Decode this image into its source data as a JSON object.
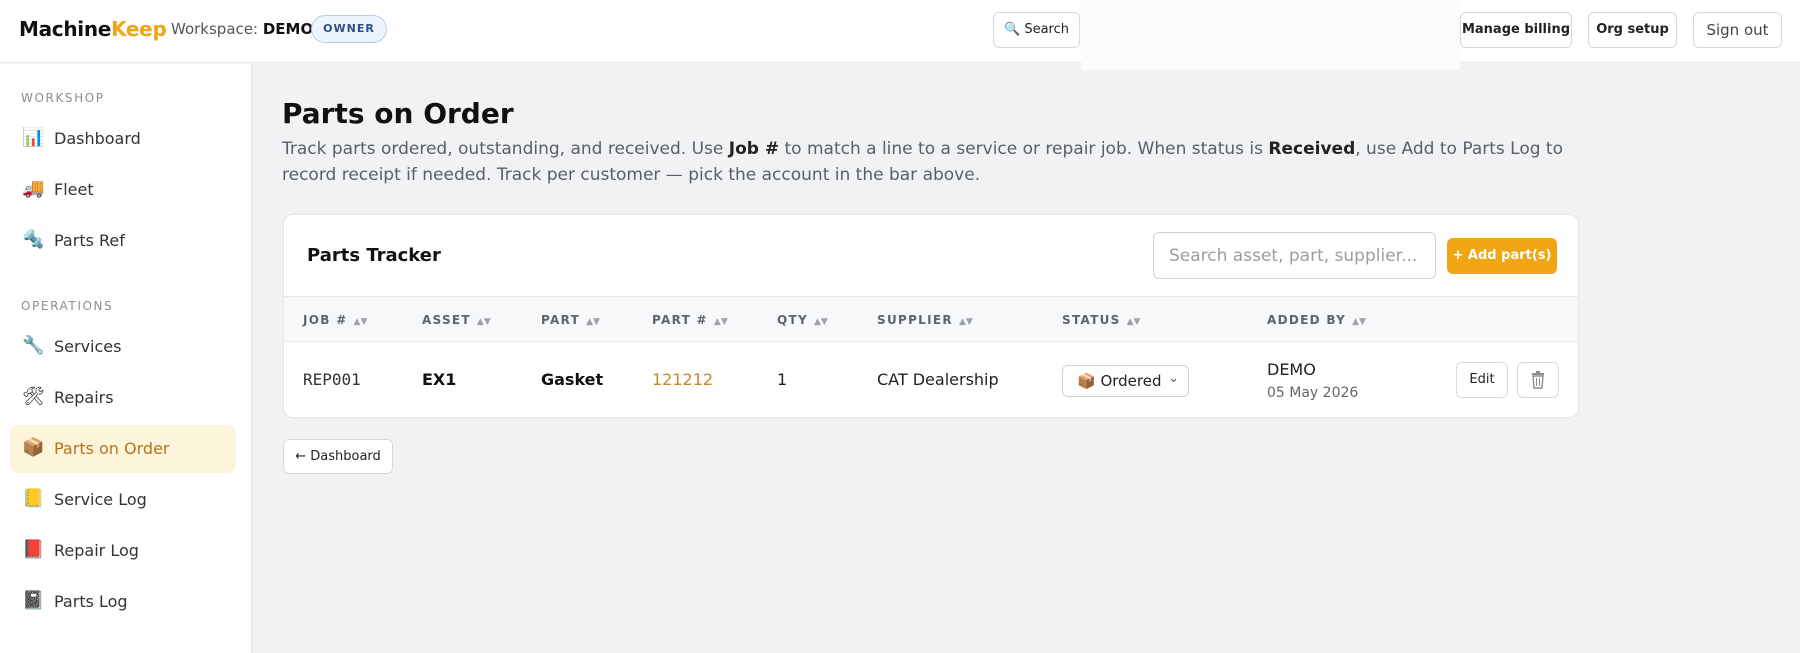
{
  "topbar": {
    "logo_main": "Machine",
    "logo_accent": "Keep",
    "workspace_label": "Workspace:",
    "workspace_name": "DEMO",
    "role_badge": "OWNER",
    "search_label": "🔍 Search",
    "billing_label": "Manage billing",
    "org_label": "Org setup",
    "signout_label": "Sign out"
  },
  "sidebar": {
    "sections": [
      {
        "title": "WORKSHOP",
        "items": [
          {
            "icon": "📊",
            "icon_name": "chart-icon",
            "label": "Dashboard"
          },
          {
            "icon": "🚚",
            "icon_name": "truck-icon",
            "label": "Fleet"
          },
          {
            "icon": "🔩",
            "icon_name": "bolt-icon",
            "label": "Parts Ref"
          }
        ]
      },
      {
        "title": "OPERATIONS",
        "items": [
          {
            "icon": "🔧",
            "icon_name": "wrench-icon",
            "label": "Services"
          },
          {
            "icon": "🛠",
            "icon_name": "tools-icon",
            "label": "Repairs"
          },
          {
            "icon": "📦",
            "icon_name": "package-icon",
            "label": "Parts on Order",
            "active": true
          },
          {
            "icon": "📒",
            "icon_name": "ledger-icon",
            "label": "Service Log"
          },
          {
            "icon": "📕",
            "icon_name": "red-book-icon",
            "label": "Repair Log"
          },
          {
            "icon": "📓",
            "icon_name": "notebook-icon",
            "label": "Parts Log"
          }
        ]
      }
    ]
  },
  "page": {
    "title": "Parts on Order",
    "desc_1": "Track parts ordered, outstanding, and received. Use ",
    "desc_bold_1": "Job #",
    "desc_2": " to match a line to a service or repair job. When status is ",
    "desc_bold_2": "Received",
    "desc_3": ", use Add to Parts Log to record receipt if needed. Track per customer — pick the account in the bar above."
  },
  "tracker": {
    "title": "Parts Tracker",
    "search_placeholder": "Search asset, part, supplier...",
    "add_label": "+ Add part(s)",
    "sort_glyph": "▲▼",
    "columns": [
      "JOB #",
      "ASSET",
      "PART",
      "PART #",
      "QTY",
      "SUPPLIER",
      "STATUS",
      "ADDED BY"
    ],
    "rows": [
      {
        "job": "REP001",
        "asset": "EX1",
        "part": "Gasket",
        "part_no": "121212",
        "qty": "1",
        "supplier": "CAT Dealership",
        "status": "📦 Ordered",
        "added_by": "DEMO",
        "added_date": "05 May 2026",
        "edit_label": "Edit"
      }
    ]
  },
  "footer": {
    "back_label": "← Dashboard"
  },
  "colors": {
    "accent": "#f0a513",
    "link": "#c28a22",
    "active_bg": "#fdf4dc"
  }
}
